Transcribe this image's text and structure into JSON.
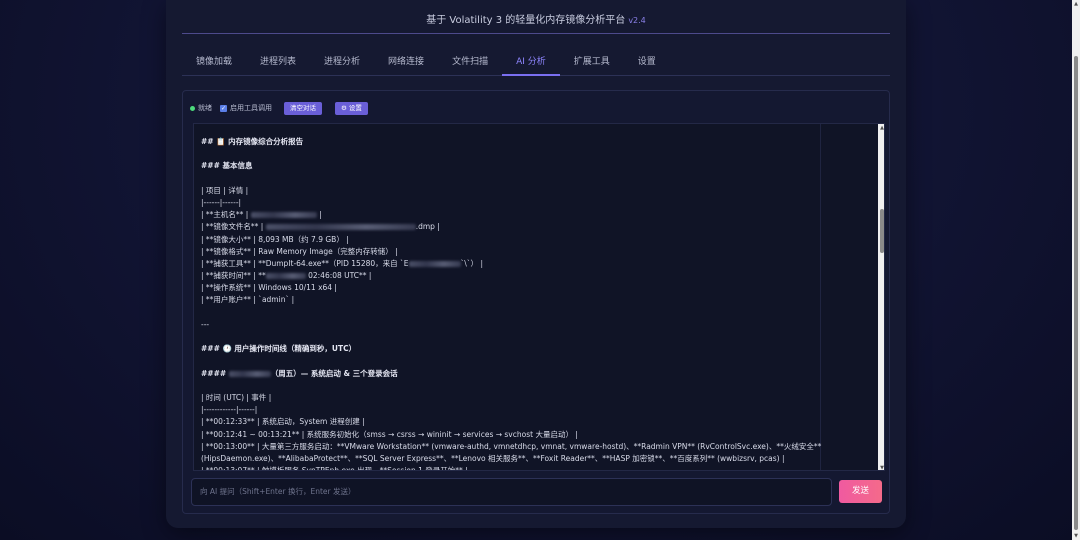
{
  "header": {
    "title": "基于 Volatility 3 的轻量化内存镜像分析平台",
    "version": "v2.4"
  },
  "tabs": [
    {
      "label": "镜像加载",
      "active": false
    },
    {
      "label": "进程列表",
      "active": false
    },
    {
      "label": "进程分析",
      "active": false
    },
    {
      "label": "网络连接",
      "active": false
    },
    {
      "label": "文件扫描",
      "active": false
    },
    {
      "label": "AI 分析",
      "active": true
    },
    {
      "label": "扩展工具",
      "active": false
    },
    {
      "label": "设置",
      "active": false
    }
  ],
  "toolbar": {
    "status": "就绪",
    "tool_toggle_label": "启用工具调用",
    "tool_toggle_checked": true,
    "clear_button": "清空对话",
    "settings_button": "⚙ 设置"
  },
  "output": {
    "lines": [
      "## 📋 内存镜像综合分析报告",
      "",
      "### 基本信息",
      "",
      "| 项目 | 详情 |",
      "|------|------|",
      "| **主机名** | ",
      "| **镜像文件名** | ",
      "| **镜像大小** | 8,093 MB（约 7.9 GB） |",
      "| **镜像格式** | Raw Memory Image（完整内存转储） |",
      "| **捕获工具** | **DumpIt-64.exe**（PID 15280，来自 `E",
      "| **捕获时间** | **",
      "| **操作系统** | Windows 10/11 x64 |",
      "| **用户账户** | `admin` |",
      "",
      "---",
      "",
      "### 🕐 用户操作时间线（精确到秒，UTC）",
      "",
      "#### ",
      "",
      "| 时间 (UTC) | 事件 |",
      "|------------|------|",
      "| **00:12:33** | 系统启动，System 进程创建 |",
      "| **00:12:41 ~ 00:13:21** | 系统服务初始化（smss → csrss → wininit → services → svchost 大量启动） |",
      "| **00:13:00** | 大量第三方服务启动：**VMware Workstation** (vmware-authd, vmnetdhcp, vmnat, vmware-hostd)、**Radmin VPN** (RvControlSvc.exe)、**火绒安全**",
      "(HipsDaemon.exe)、**AlibabaProtect**、**SQL Server Express**、**Lenovo 相关服务**、**Foxit Reader**、**HASP 加密锁**、**百度系列** (wwbizsrv, pcas) |",
      "| **00:13:07** | 触摸板服务 SynTPEnh.exe 出现，**Session 1 登录开始** |"
    ],
    "suffixes": {
      "6": " |",
      "7": ".dmp |",
      "10": "`\\`） |",
      "11": " 02:46:08 UTC** |",
      "19": "（周五）— 系统启动 & 三个登录会话"
    }
  },
  "input": {
    "placeholder": "向 AI 提问（Shift+Enter 换行，Enter 发送）"
  },
  "send_button": "发送",
  "colors": {
    "accent": "#7a6ff0",
    "send": "#f05aa0",
    "status_dot": "#4cd97b"
  }
}
